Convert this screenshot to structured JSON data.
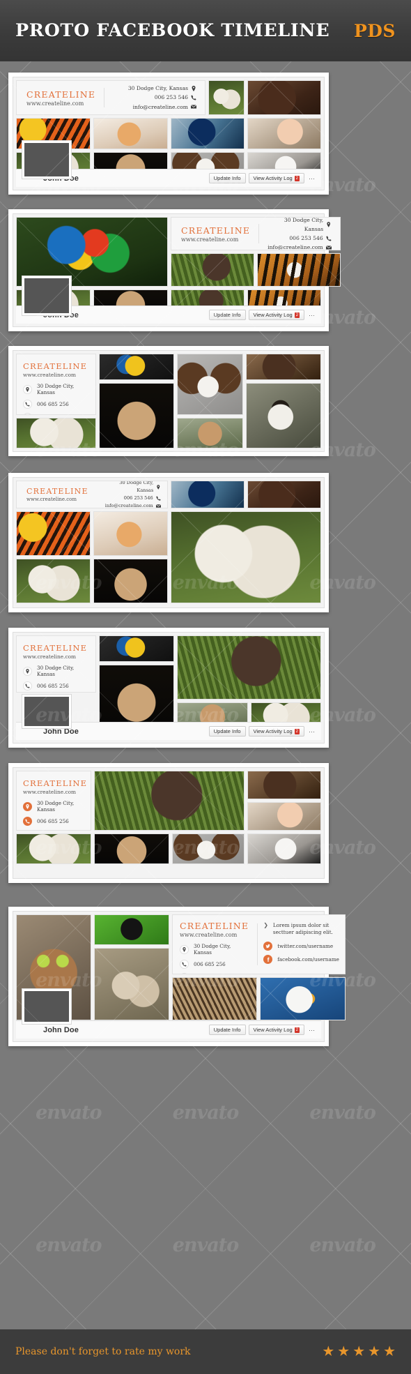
{
  "header": {
    "title": "PROTO FACEBOOK TIMELINE",
    "format_label": "PDS"
  },
  "brand": {
    "name": "CREATELINE",
    "website": "www.createline.com",
    "address": "30 Dodge City, Kansas",
    "phone_variant_a": "006 253 546",
    "phone_variant_b": "006 685 256",
    "email": "info@createline.com",
    "tagline": "Lorem ipsum dolor sit secttuer adipiscing elit.",
    "twitter": "twitter.com/username",
    "facebook": "facebook.com/username",
    "accent_color": "#e2703a"
  },
  "fb_bar": {
    "profile_name": "John Doe",
    "update_info_label": "Update Info",
    "activity_log_label": "View Activity Log",
    "activity_badge": "2",
    "more_label": "···"
  },
  "icons": {
    "location": "location-pin-icon",
    "phone": "phone-icon",
    "email": "envelope-icon",
    "chevron": "chevron-right-icon",
    "twitter": "twitter-icon",
    "facebook": "facebook-icon"
  },
  "watermark": {
    "text": "envato"
  },
  "footer": {
    "rate_text": "Please don't forget to rate my work",
    "stars": [
      "★",
      "★",
      "★",
      "★",
      "★"
    ],
    "star_color": "#e8962c",
    "background": "#3c3c3c"
  },
  "mockups": [
    {
      "id": 1,
      "layout": "header-strip-top"
    },
    {
      "id": 2,
      "layout": "big-photo-left"
    },
    {
      "id": 3,
      "layout": "contact-card-left"
    },
    {
      "id": 4,
      "layout": "header-strip-compact"
    },
    {
      "id": 5,
      "layout": "vertical-card-grid"
    },
    {
      "id": 6,
      "layout": "vertical-card-wide"
    },
    {
      "id": 7,
      "layout": "social-panel-right"
    }
  ]
}
